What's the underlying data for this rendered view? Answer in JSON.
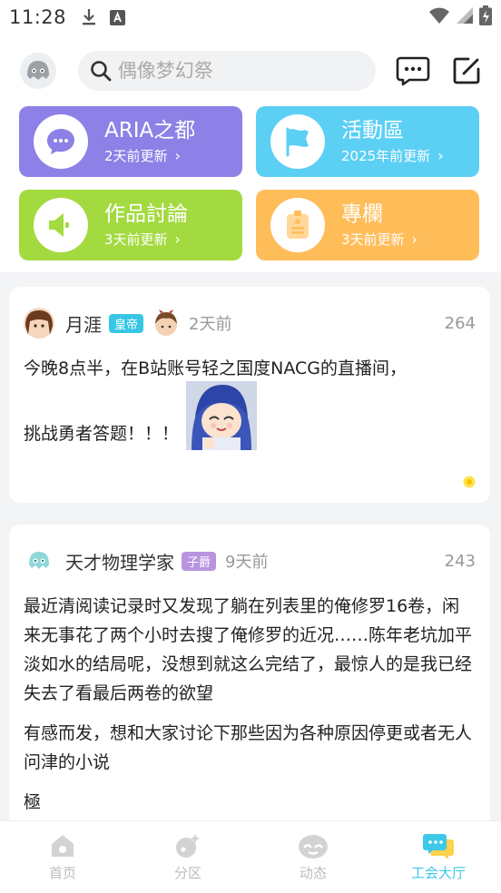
{
  "status_bar": {
    "time": "11:28"
  },
  "header": {
    "search_placeholder": "偶像梦幻祭"
  },
  "sections": [
    {
      "title": "ARIA之都",
      "sub": "2天前更新",
      "color": "#8d80e6",
      "icon": "chat-bubble-icon"
    },
    {
      "title": "活動區",
      "sub": "2025年前更新",
      "color": "#5ccff5",
      "icon": "flag-icon"
    },
    {
      "title": "作品討論",
      "sub": "3天前更新",
      "color": "#a3da3f",
      "icon": "speaker-icon"
    },
    {
      "title": "專欄",
      "sub": "3天前更新",
      "color": "#ffbd5a",
      "icon": "badge-icon"
    }
  ],
  "posts": [
    {
      "user": "月涯",
      "badge": "皇帝",
      "badge_color": "#37c7e3",
      "time": "2天前",
      "count": "264",
      "line1": "今晚8点半，在B站账号轻之国度NACG的直播间，",
      "line2": "挑战勇者答题！！！"
    },
    {
      "user": "天才物理学家",
      "badge": "子爵",
      "badge_color": "#b993e0",
      "time": "9天前",
      "count": "243",
      "para1": "最近清阅读记录时又发现了躺在列表里的俺修罗16卷，闲来无事花了两个小时去搜了俺修罗的近况……陈年老坑加平淡如水的结局呢，没想到就这么完结了，最惊人的是我已经失去了看最后两卷的欲望",
      "para2": "有感而发，想和大家讨论下那些因为各种原因停更或者无人问津的小说",
      "para3": "極"
    }
  ],
  "nav": [
    {
      "label": "首页"
    },
    {
      "label": "分区"
    },
    {
      "label": "动态"
    },
    {
      "label": "工会大厅"
    }
  ],
  "colors": {
    "accent": "#3cc9e8",
    "nav_inactive": "#d3d3d3"
  }
}
